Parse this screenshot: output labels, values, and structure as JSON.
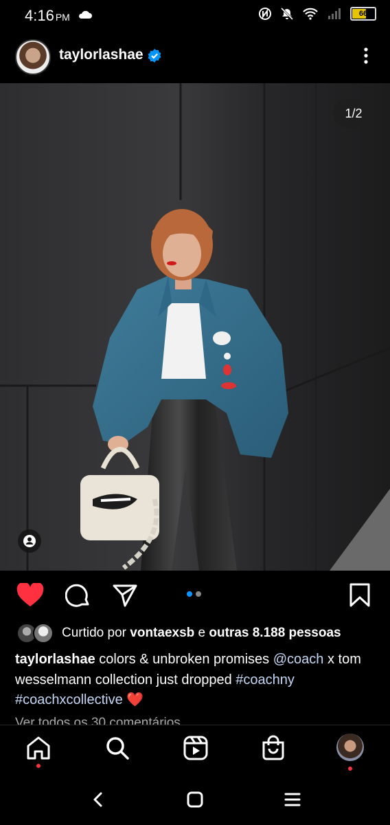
{
  "status_bar": {
    "time": "4:16",
    "ampm": "PM",
    "battery": "66"
  },
  "post": {
    "username": "taylorlashae",
    "pager": "1/2",
    "likes": {
      "prefix": "Curtido por ",
      "user": "vontaexsb",
      "mid": " e ",
      "others": "outras 8.188 pessoas"
    },
    "caption": {
      "user": "taylorlashae",
      "text1": " colors & unbroken promises ",
      "mention": "@coach",
      "text2": " x tom wesselmann collection just dropped ",
      "tag1": "#coachny",
      "tag2": "#coachxcollective",
      "emoji": " ❤️"
    },
    "view_comments": "Ver todos os 30 comentários"
  },
  "colors": {
    "like_red": "#ff3040",
    "pager_active": "#0a95ff",
    "verified_blue": "#0095f6"
  },
  "icons": {
    "status": [
      "nfc-icon",
      "mute-icon",
      "wifi-icon",
      "signal-icon",
      "battery-icon"
    ],
    "actions": [
      "heart-icon",
      "comment-icon",
      "share-icon",
      "bookmark-icon"
    ],
    "nav": [
      "home-icon",
      "search-icon",
      "reels-icon",
      "shop-icon",
      "profile-avatar"
    ],
    "system": [
      "back-icon",
      "home-button-icon",
      "recents-icon"
    ]
  }
}
